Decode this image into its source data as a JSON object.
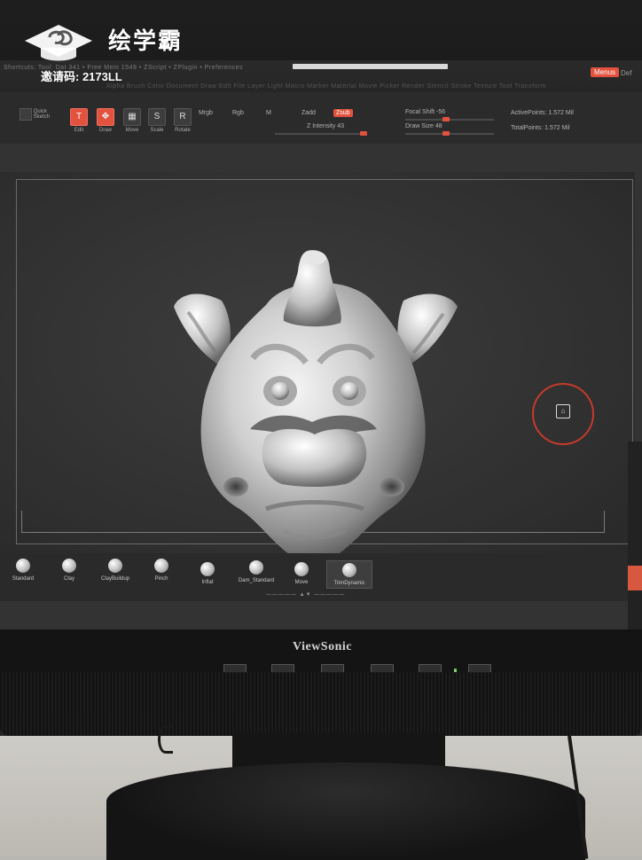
{
  "watermark": {
    "title": "绘学霸",
    "invite_code": "邀请码: 2173LL"
  },
  "zbrush": {
    "menus_button": "Menus",
    "default_label": "Def",
    "menu_line": "Shortcuts:  Tool: Dat 341  •  Free Mem 1549  •  ZScript  •  ZPlugin  •  Preferences",
    "menu_line2": "Alpha  Brush  Color  Document  Draw  Edit  File  Layer  Light  Macro  Marker  Material  Movie  Picker  Render  Stencil  Stroke  Texture  Tool  Transform",
    "toolbar": {
      "quick_sketch": "Quick\nSketch",
      "edit": "Edit",
      "draw": "Draw",
      "move": "Move",
      "scale": "Scale",
      "rotate": "Rotate",
      "mrgb": "Mrgb",
      "rgb": "Rgb",
      "m": "M",
      "zadd": "Zadd",
      "zsub": "Zsub",
      "z_intensity": "Z Intensity 43",
      "focal_shift": "Focal Shift -56",
      "draw_size": "Draw Size 48",
      "active_points": "ActivePoints: 1.572 Mil",
      "total_points": "TotalPoints: 1.572 Mil"
    },
    "brushes": [
      {
        "label": "Standard"
      },
      {
        "label": "Clay"
      },
      {
        "label": "ClayBuildup"
      },
      {
        "label": "Pinch"
      },
      {
        "label": "Inflat"
      },
      {
        "label": "Dam_Standard"
      },
      {
        "label": "Move"
      },
      {
        "label": "TrimDynamic"
      }
    ],
    "accent": "#e2523f"
  },
  "monitor": {
    "brand": "ViewSonic"
  }
}
